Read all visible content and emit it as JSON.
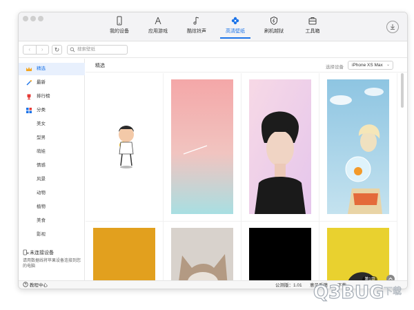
{
  "top_nav": {
    "items": [
      {
        "label": "我的设备",
        "icon": "phone-icon"
      },
      {
        "label": "应用游戏",
        "icon": "appstore-icon"
      },
      {
        "label": "酷炫铃声",
        "icon": "music-note-icon"
      },
      {
        "label": "高清壁纸",
        "icon": "flower-icon"
      },
      {
        "label": "刷机越狱",
        "icon": "flash-icon"
      },
      {
        "label": "工具箱",
        "icon": "toolbox-icon"
      }
    ],
    "active_index": 3
  },
  "toolbar": {
    "search_placeholder": "搜索壁纸",
    "refresh_glyph": "↻",
    "back_glyph": "‹",
    "forward_glyph": "›"
  },
  "sidebar": {
    "items": [
      {
        "label": "精选",
        "icon": "crown-icon"
      },
      {
        "label": "最新",
        "icon": "magic-wand-icon"
      },
      {
        "label": "排行榜",
        "icon": "trophy-icon"
      },
      {
        "label": "分类",
        "icon": "category-grid-icon"
      }
    ],
    "sub_items": [
      "美女",
      "型男",
      "萌娃",
      "情感",
      "风景",
      "动物",
      "植物",
      "美食",
      "影视"
    ],
    "device_status_title": "未连接设备",
    "device_status_desc": "请用数据线将苹果设备连接到您的电脑"
  },
  "main": {
    "title": "精选",
    "device_label": "选择设备",
    "device_value": "iPhone XS Max",
    "page_badge": "第1页"
  },
  "statusbar": {
    "help": "教程中心",
    "version": "公测版：1.01",
    "feedback": "意见反馈",
    "download": "下载"
  },
  "watermark": "Q3BUG下载",
  "colors": {
    "accent": "#1b73e8",
    "active_bg": "#e8f0fd"
  }
}
